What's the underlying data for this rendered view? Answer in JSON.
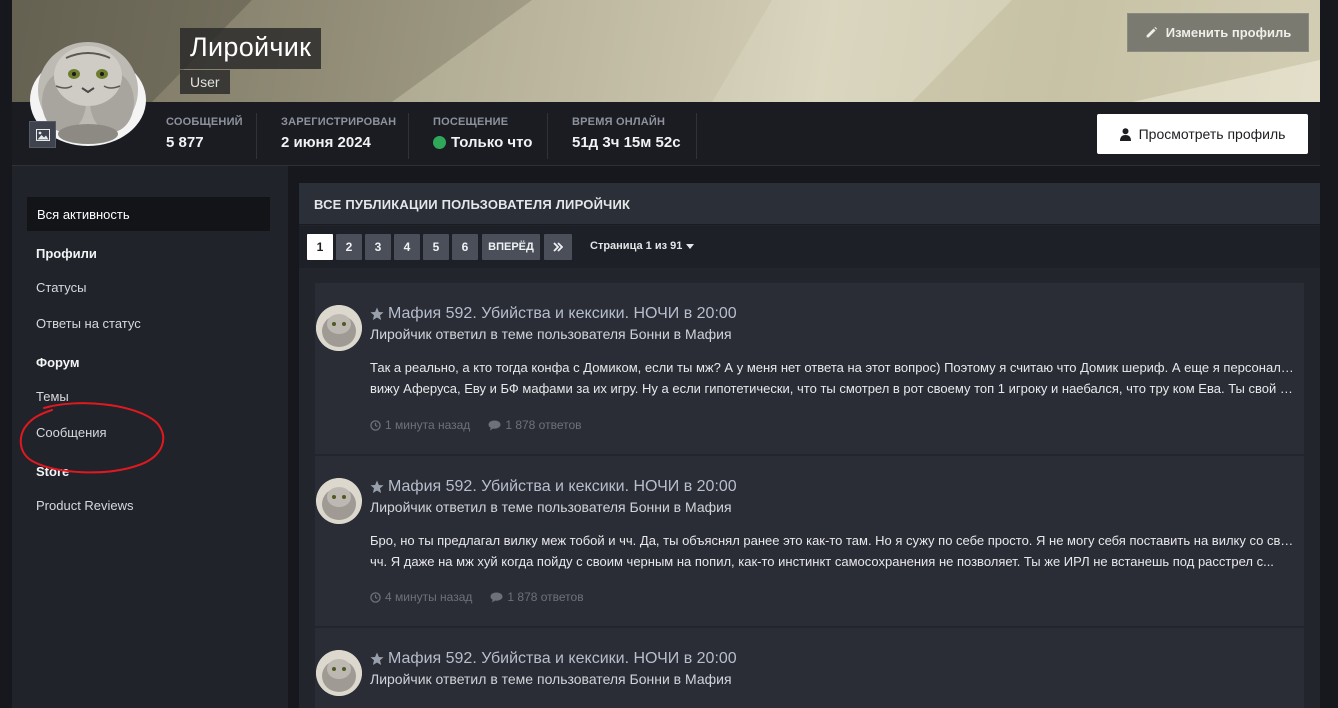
{
  "header": {
    "user_name": "Лиройчик",
    "user_group": "User",
    "edit_profile_label": "Изменить профиль",
    "view_profile_label": "Просмотреть профиль"
  },
  "stats": [
    {
      "label": "СООБЩЕНИЙ",
      "value": "5 877"
    },
    {
      "label": "ЗАРЕГИСТРИРОВАН",
      "value": "2 июня 2024"
    },
    {
      "label": "ПОСЕЩЕНИЕ",
      "value": "Только что"
    },
    {
      "label": "ВРЕМЯ ОНЛАЙН",
      "value": "51д 3ч 15м 52с"
    }
  ],
  "sidebar": {
    "all_activity": "Вся активность",
    "group_profiles": "Профили",
    "statuses": "Статусы",
    "status_replies": "Ответы на статус",
    "group_forum": "Форум",
    "topics": "Темы",
    "messages": "Сообщения",
    "group_store": "Store",
    "product_reviews": "Product Reviews"
  },
  "main": {
    "title": "ВСЕ ПУБЛИКАЦИИ ПОЛЬЗОВАТЕЛЯ ЛИРОЙЧИК",
    "pages": [
      "1",
      "2",
      "3",
      "4",
      "5",
      "6"
    ],
    "next_label": "ВПЕРЁД",
    "page_info": "Страница 1 из 91"
  },
  "posts": [
    {
      "title": "Мафия 592. Убийства и кексики. НОЧИ в 20:00",
      "subtitle": "Лиройчик ответил в теме пользователя Бонни в Мафия",
      "line1": "Так а реально, а кто тогда конфа с Домиком, если ты мж? А у меня нет ответа на этот вопрос) Поэтому я считаю что Домик шериф. А еще я персонально",
      "line2": "вижу Аферуса, Еву и БФ мафами за их игру. Ну а если гипотетически, что ты смотрел в рот своему топ 1 игроку и наебался, что тру ком Ева. Ты свой цвет...",
      "time": "1 минута назад",
      "replies": "1 878 ответов"
    },
    {
      "title": "Мафия 592. Убийства и кексики. НОЧИ в 20:00",
      "subtitle": "Лиройчик ответил в теме пользователя Бонни в Мафия",
      "line1": "Бро, но ты предлагал вилку меж тобой и чч. Да, ты объяснял ранее это как-то там. Но я сужу по себе просто. Я не могу себя поставить на вилку со своим",
      "line2": "чч. Я даже на мж хуй когда пойду с своим черным на попил, как-то инстинкт самосохранения не позволяет. Ты же ИРЛ не встанешь под расстрел с...",
      "time": "4 минуты назад",
      "replies": "1 878 ответов"
    },
    {
      "title": "Мафия 592. Убийства и кексики. НОЧИ в 20:00",
      "subtitle": "Лиройчик ответил в теме пользователя Бонни в Мафия"
    }
  ],
  "colors": {
    "accent_online": "#2fa85a",
    "annotation": "#e0191f"
  }
}
